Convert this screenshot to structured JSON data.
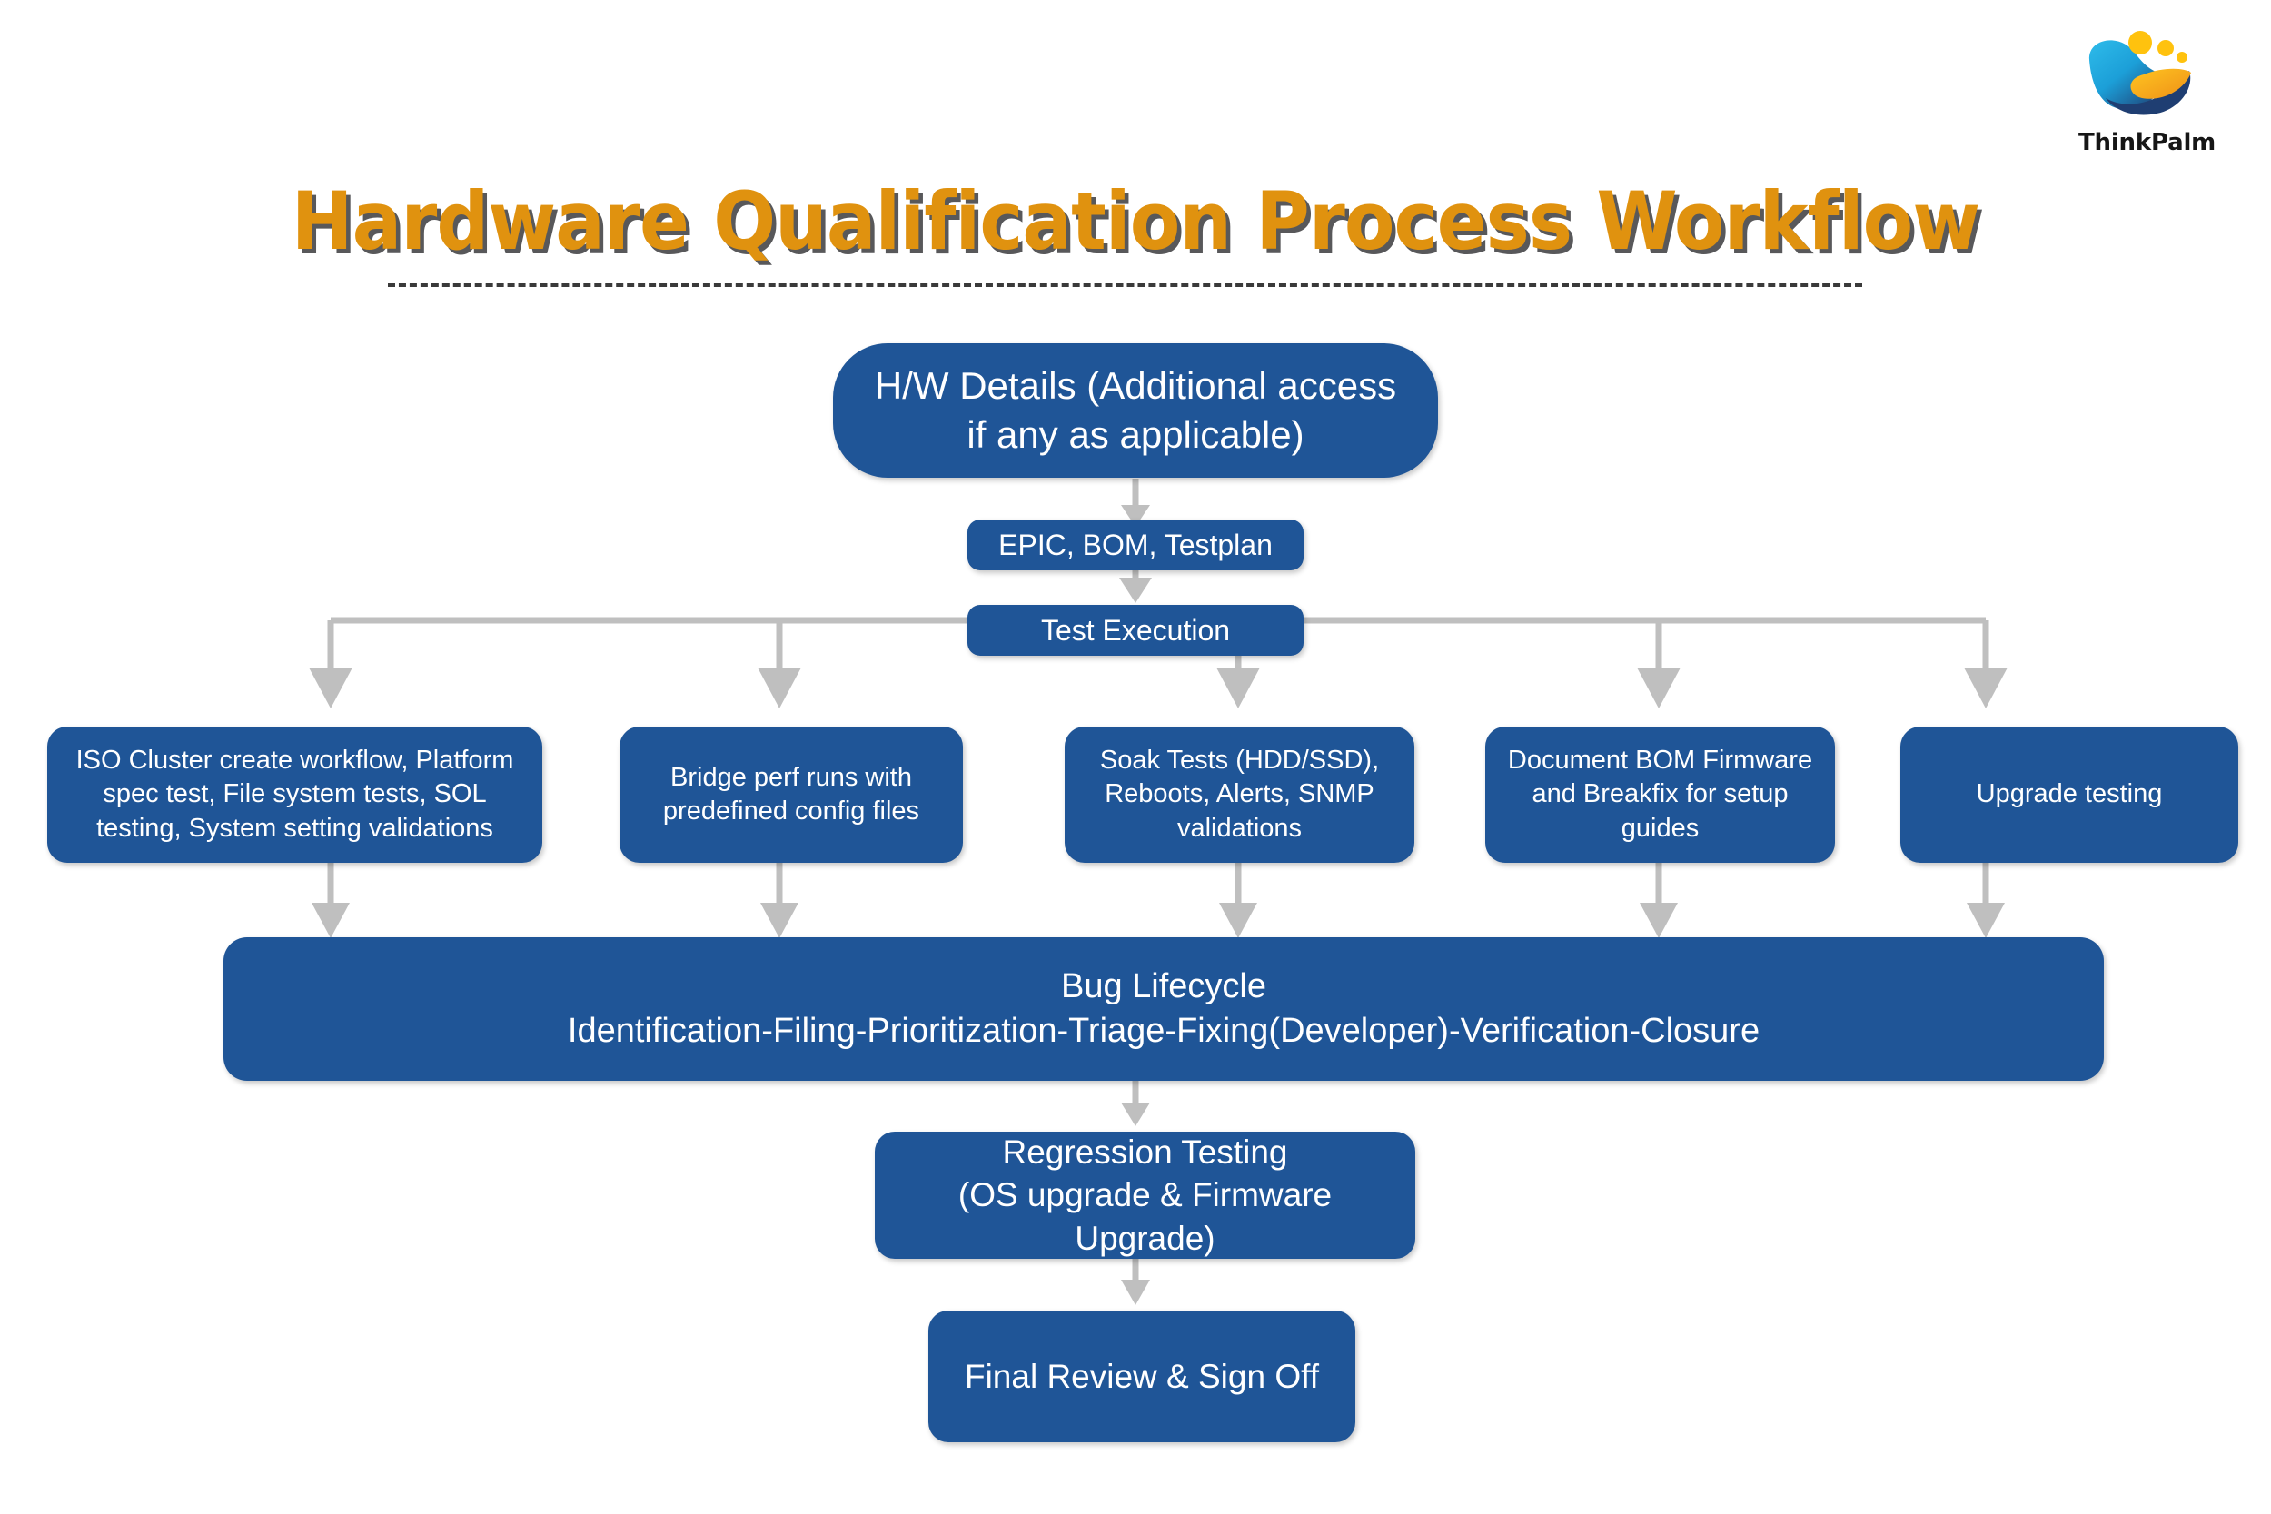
{
  "brand": {
    "logo_name": "thinkpalm-logo",
    "wordmark": "ThinkPalm",
    "logo_blue": "#1BA3DC",
    "logo_dark_blue": "#1F3E72",
    "logo_yellow": "#FFC20E",
    "logo_orange": "#F4A11E"
  },
  "header": {
    "title": "Hardware Qualification Process Workflow",
    "title_color": "#E0920F",
    "title_shadow_color": "#58585A",
    "rule_style": "dashed",
    "rule_color": "#3A3A3A"
  },
  "theme": {
    "node_fill": "#1F5597",
    "node_text": "#FFFFFF",
    "connector_color": "#BFBFBF",
    "background": "#FFFFFF"
  },
  "nodes": {
    "hw_details": "H/W Details (Additional access\nif any as applicable)",
    "epic_bom_testplan": "EPIC, BOM, Testplan",
    "test_execution": "Test Execution",
    "branch_1": "ISO Cluster create workflow, Platform\nspec test, File system tests, SOL\ntesting, System setting validations",
    "branch_2": "Bridge perf runs with\npredefined config files",
    "branch_3": "Soak Tests (HDD/SSD),\nReboots, Alerts, SNMP\nvalidations",
    "branch_4": "Document BOM Firmware\nand Breakfix for setup\nguides",
    "branch_5": "Upgrade testing",
    "bug_lifecycle_title": "Bug Lifecycle",
    "bug_lifecycle_detail": "Identification-Filing-Prioritization-Triage-Fixing(Developer)-Verification-Closure",
    "regression_testing": "Regression Testing\n(OS upgrade & Firmware Upgrade)",
    "final_review": "Final Review & Sign Off"
  },
  "flow": {
    "edges": [
      "hw_details -> epic_bom_testplan",
      "epic_bom_testplan -> test_execution",
      "test_execution -> branch_1",
      "test_execution -> branch_2",
      "test_execution -> branch_3",
      "test_execution -> branch_4",
      "test_execution -> branch_5",
      "branch_1 -> bug_lifecycle",
      "branch_2 -> bug_lifecycle",
      "branch_3 -> bug_lifecycle",
      "branch_4 -> bug_lifecycle",
      "branch_5 -> bug_lifecycle",
      "bug_lifecycle -> regression_testing",
      "regression_testing -> final_review"
    ]
  }
}
